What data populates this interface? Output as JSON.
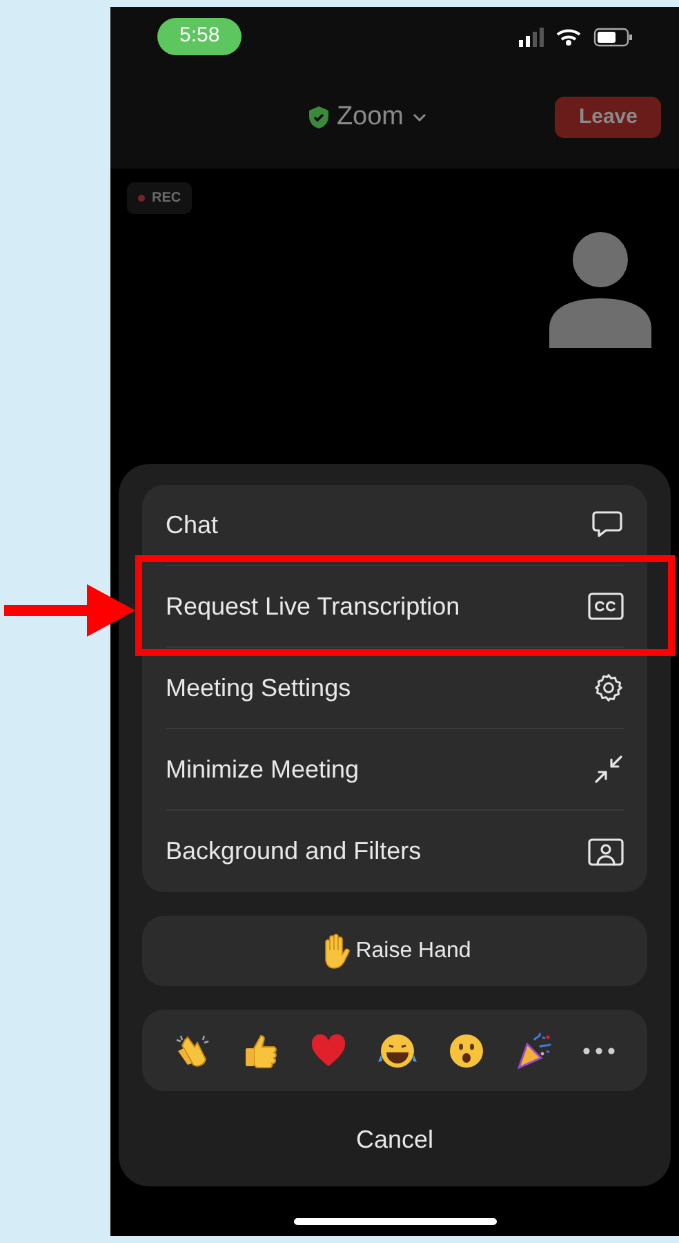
{
  "status_bar": {
    "time": "5:58"
  },
  "header": {
    "title": "Zoom",
    "leave_button": "Leave"
  },
  "recording_badge": {
    "label": "REC"
  },
  "menu": [
    {
      "label": "Chat",
      "highlighted": false
    },
    {
      "label": "Request Live Transcription",
      "highlighted": true
    },
    {
      "label": "Meeting Settings",
      "highlighted": false
    },
    {
      "label": "Minimize Meeting",
      "highlighted": false
    },
    {
      "label": "Background and Filters",
      "highlighted": false
    }
  ],
  "raise_hand": {
    "label": "Raise Hand"
  },
  "reactions": [
    {
      "kind": "clap"
    },
    {
      "kind": "thumbs_up"
    },
    {
      "kind": "heart"
    },
    {
      "kind": "laugh"
    },
    {
      "kind": "surprised"
    },
    {
      "kind": "party"
    },
    {
      "kind": "more"
    }
  ],
  "cancel": "Cancel"
}
